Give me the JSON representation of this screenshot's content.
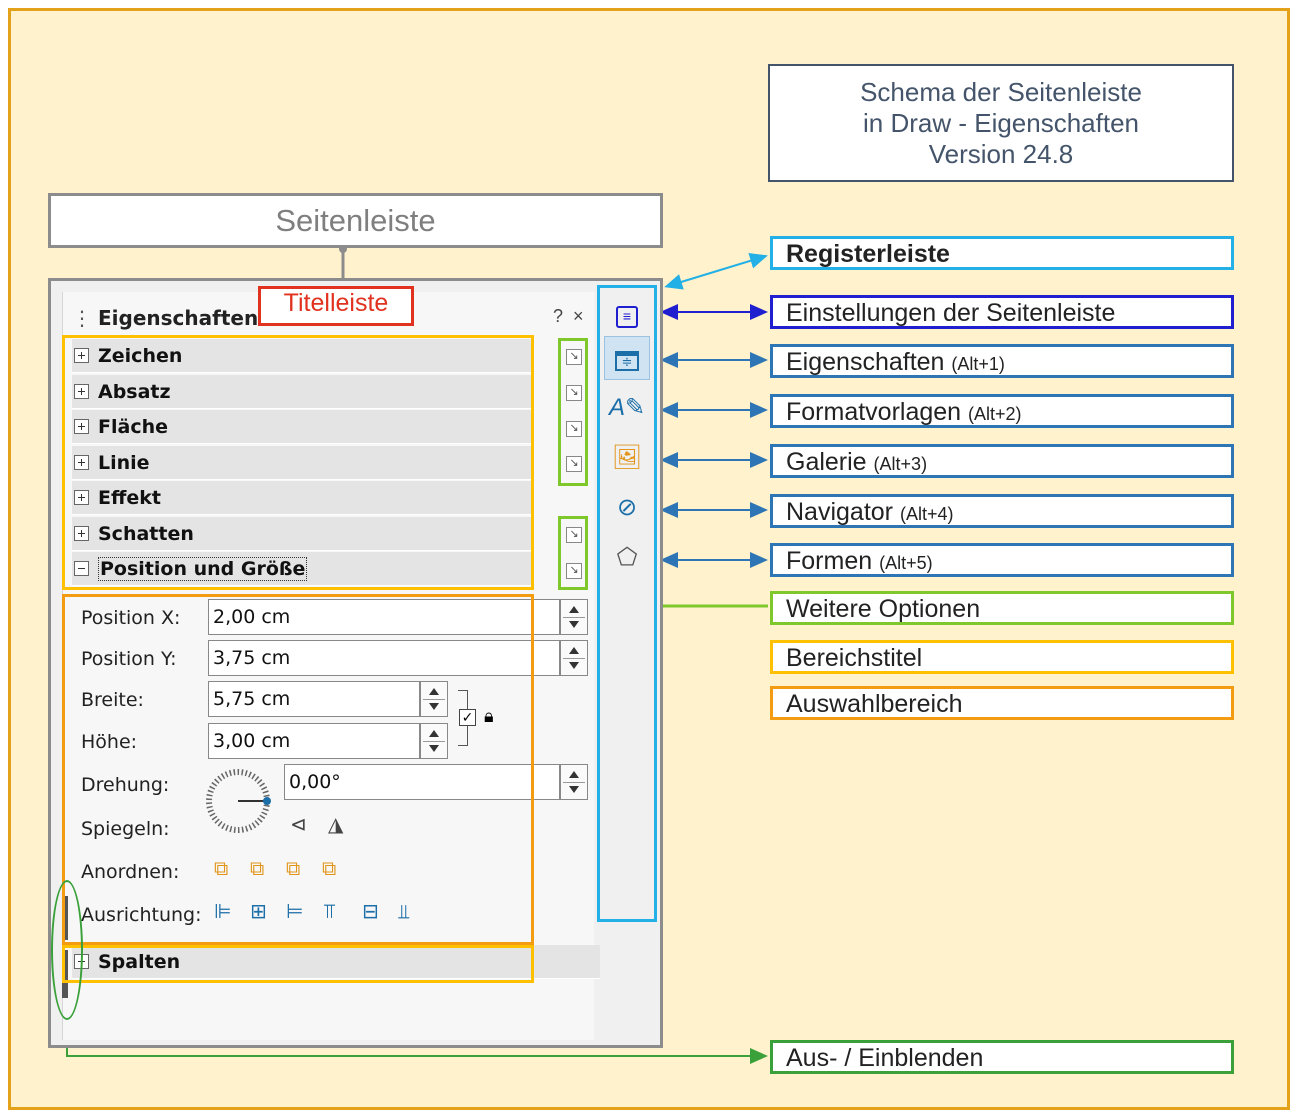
{
  "diagram_title": [
    "Schema der Seitenleiste",
    "in Draw - Eigenschaften",
    "Version 24.8"
  ],
  "sidebar_heading": "Seitenleiste",
  "titlebar_callout": "Titelleiste",
  "panel": {
    "title": "Eigenschaften",
    "help": "?",
    "close": "×",
    "sections": [
      "Zeichen",
      "Absatz",
      "Fläche",
      "Linie",
      "Effekt",
      "Schatten",
      "Position und Größe"
    ],
    "last_section": "Spalten",
    "fields": {
      "pos_x_label": "Position X:",
      "pos_x_value": "2,00 cm",
      "pos_y_label": "Position Y:",
      "pos_y_value": "3,75 cm",
      "width_label": "Breite:",
      "width_value": "5,75 cm",
      "height_label": "Höhe:",
      "height_value": "3,00 cm",
      "rotation_label": "Drehung:",
      "rotation_value": "0,00°",
      "mirror_label": "Spiegeln:",
      "arrange_label": "Anordnen:",
      "align_label": "Ausrichtung:"
    },
    "icons": {
      "mirror": [
        "⊲",
        "◮"
      ],
      "arrange": [
        "⧉",
        "⧉",
        "⧉",
        "⧉"
      ],
      "align": [
        "⊫",
        "⊞",
        "⊨",
        "⫪",
        "⊟",
        "⫫"
      ]
    }
  },
  "tabs": [
    "settings-icon",
    "properties-icon",
    "styles-icon",
    "gallery-icon",
    "navigator-icon",
    "shapes-icon"
  ],
  "legend": {
    "registerleiste": "Registerleiste",
    "settings": "Einstellungen der Seitenleiste",
    "properties": "Eigenschaften",
    "properties_key": "(Alt+1)",
    "styles": "Formatvorlagen",
    "styles_key": "(Alt+2)",
    "gallery": "Galerie",
    "gallery_key": "(Alt+3)",
    "navigator": "Navigator",
    "navigator_key": "(Alt+4)",
    "shapes": "Formen",
    "shapes_key": "(Alt+5)",
    "more_options": "Weitere Optionen",
    "section_title": "Bereichstitel",
    "selection_area": "Auswahlbereich",
    "show_hide": "Aus- / Einblenden"
  },
  "colors": {
    "background": "#fff2cc",
    "frame": "#e3a21a",
    "tabbar": "#22b0e6",
    "dark_blue": "#1f1fcf",
    "mid_blue": "#2e75b6",
    "green": "#7ec82c",
    "dark_green": "#3aa13a",
    "yellow": "#ffc000",
    "orange": "#f39c12",
    "red": "#e0321e",
    "slate": "#44546a"
  }
}
